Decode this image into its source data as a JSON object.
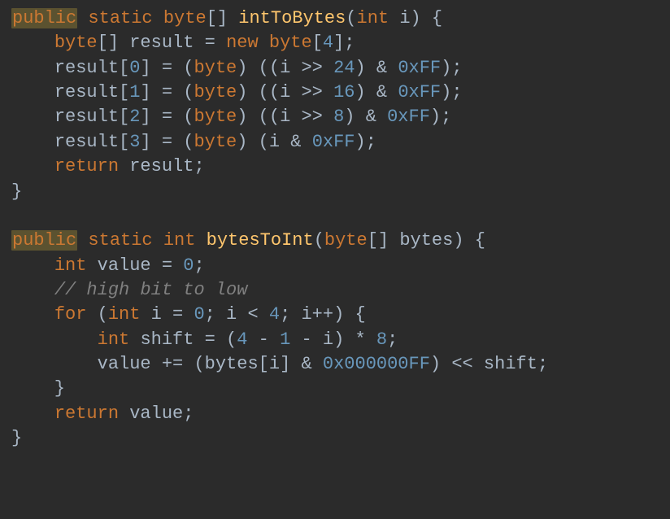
{
  "code_tokens": [
    [
      {
        "cls": "kw hl-public",
        "t": "public"
      },
      {
        "cls": "punc",
        "t": " "
      },
      {
        "cls": "kw",
        "t": "static "
      },
      {
        "cls": "type",
        "t": "byte"
      },
      {
        "cls": "punc",
        "t": "[] "
      },
      {
        "cls": "def",
        "t": "intToBytes"
      },
      {
        "cls": "punc",
        "t": "("
      },
      {
        "cls": "type",
        "t": "int "
      },
      {
        "cls": "var",
        "t": "i"
      },
      {
        "cls": "punc",
        "t": ") {"
      }
    ],
    [
      {
        "cls": "punc",
        "t": "    "
      },
      {
        "cls": "type",
        "t": "byte"
      },
      {
        "cls": "punc",
        "t": "[] "
      },
      {
        "cls": "var",
        "t": "result "
      },
      {
        "cls": "punc",
        "t": "= "
      },
      {
        "cls": "kw",
        "t": "new "
      },
      {
        "cls": "type",
        "t": "byte"
      },
      {
        "cls": "punc",
        "t": "["
      },
      {
        "cls": "num",
        "t": "4"
      },
      {
        "cls": "punc",
        "t": "];"
      }
    ],
    [
      {
        "cls": "punc",
        "t": "    "
      },
      {
        "cls": "var",
        "t": "result"
      },
      {
        "cls": "punc",
        "t": "["
      },
      {
        "cls": "num",
        "t": "0"
      },
      {
        "cls": "punc",
        "t": "] = ("
      },
      {
        "cls": "type",
        "t": "byte"
      },
      {
        "cls": "punc",
        "t": ") ((i >> "
      },
      {
        "cls": "num",
        "t": "24"
      },
      {
        "cls": "punc",
        "t": ") & "
      },
      {
        "cls": "num",
        "t": "0xFF"
      },
      {
        "cls": "punc",
        "t": ");"
      }
    ],
    [
      {
        "cls": "punc",
        "t": "    "
      },
      {
        "cls": "var",
        "t": "result"
      },
      {
        "cls": "punc",
        "t": "["
      },
      {
        "cls": "num",
        "t": "1"
      },
      {
        "cls": "punc",
        "t": "] = ("
      },
      {
        "cls": "type",
        "t": "byte"
      },
      {
        "cls": "punc",
        "t": ") ((i >> "
      },
      {
        "cls": "num",
        "t": "16"
      },
      {
        "cls": "punc",
        "t": ") & "
      },
      {
        "cls": "num",
        "t": "0xFF"
      },
      {
        "cls": "punc",
        "t": ");"
      }
    ],
    [
      {
        "cls": "punc",
        "t": "    "
      },
      {
        "cls": "var",
        "t": "result"
      },
      {
        "cls": "punc",
        "t": "["
      },
      {
        "cls": "num",
        "t": "2"
      },
      {
        "cls": "punc",
        "t": "] = ("
      },
      {
        "cls": "type",
        "t": "byte"
      },
      {
        "cls": "punc",
        "t": ") ((i >> "
      },
      {
        "cls": "num",
        "t": "8"
      },
      {
        "cls": "punc",
        "t": ") & "
      },
      {
        "cls": "num",
        "t": "0xFF"
      },
      {
        "cls": "punc",
        "t": ");"
      }
    ],
    [
      {
        "cls": "punc",
        "t": "    "
      },
      {
        "cls": "var",
        "t": "result"
      },
      {
        "cls": "punc",
        "t": "["
      },
      {
        "cls": "num",
        "t": "3"
      },
      {
        "cls": "punc",
        "t": "] = ("
      },
      {
        "cls": "type",
        "t": "byte"
      },
      {
        "cls": "punc",
        "t": ") (i & "
      },
      {
        "cls": "num",
        "t": "0xFF"
      },
      {
        "cls": "punc",
        "t": ");"
      }
    ],
    [
      {
        "cls": "punc",
        "t": "    "
      },
      {
        "cls": "kw",
        "t": "return "
      },
      {
        "cls": "var",
        "t": "result"
      },
      {
        "cls": "punc",
        "t": ";"
      }
    ],
    [
      {
        "cls": "punc",
        "t": "}"
      }
    ],
    [
      {
        "cls": "punc",
        "t": ""
      }
    ],
    [
      {
        "cls": "kw hl-public",
        "t": "public"
      },
      {
        "cls": "punc",
        "t": " "
      },
      {
        "cls": "kw",
        "t": "static "
      },
      {
        "cls": "type",
        "t": "int "
      },
      {
        "cls": "def",
        "t": "bytesToInt"
      },
      {
        "cls": "punc",
        "t": "("
      },
      {
        "cls": "type",
        "t": "byte"
      },
      {
        "cls": "punc",
        "t": "[] "
      },
      {
        "cls": "var",
        "t": "bytes"
      },
      {
        "cls": "punc",
        "t": ") {"
      }
    ],
    [
      {
        "cls": "punc",
        "t": "    "
      },
      {
        "cls": "type",
        "t": "int "
      },
      {
        "cls": "var",
        "t": "value "
      },
      {
        "cls": "punc",
        "t": "= "
      },
      {
        "cls": "num",
        "t": "0"
      },
      {
        "cls": "punc",
        "t": ";"
      }
    ],
    [
      {
        "cls": "punc",
        "t": "    "
      },
      {
        "cls": "cmt",
        "t": "// high bit to low"
      }
    ],
    [
      {
        "cls": "punc",
        "t": "    "
      },
      {
        "cls": "kw",
        "t": "for "
      },
      {
        "cls": "punc",
        "t": "("
      },
      {
        "cls": "type",
        "t": "int "
      },
      {
        "cls": "var",
        "t": "i "
      },
      {
        "cls": "punc",
        "t": "= "
      },
      {
        "cls": "num",
        "t": "0"
      },
      {
        "cls": "punc",
        "t": "; i < "
      },
      {
        "cls": "num",
        "t": "4"
      },
      {
        "cls": "punc",
        "t": "; i++) {"
      }
    ],
    [
      {
        "cls": "punc",
        "t": "        "
      },
      {
        "cls": "type",
        "t": "int "
      },
      {
        "cls": "var",
        "t": "shift "
      },
      {
        "cls": "punc",
        "t": "= ("
      },
      {
        "cls": "num",
        "t": "4"
      },
      {
        "cls": "punc",
        "t": " - "
      },
      {
        "cls": "num",
        "t": "1"
      },
      {
        "cls": "punc",
        "t": " - i) * "
      },
      {
        "cls": "num",
        "t": "8"
      },
      {
        "cls": "punc",
        "t": ";"
      }
    ],
    [
      {
        "cls": "punc",
        "t": "        "
      },
      {
        "cls": "var",
        "t": "value "
      },
      {
        "cls": "punc",
        "t": "+= (bytes[i] & "
      },
      {
        "cls": "num",
        "t": "0x000000FF"
      },
      {
        "cls": "punc",
        "t": ") << shift;"
      }
    ],
    [
      {
        "cls": "punc",
        "t": "    }"
      }
    ],
    [
      {
        "cls": "punc",
        "t": "    "
      },
      {
        "cls": "kw",
        "t": "return "
      },
      {
        "cls": "var",
        "t": "value"
      },
      {
        "cls": "punc",
        "t": ";"
      }
    ],
    [
      {
        "cls": "punc",
        "t": "}"
      }
    ]
  ]
}
